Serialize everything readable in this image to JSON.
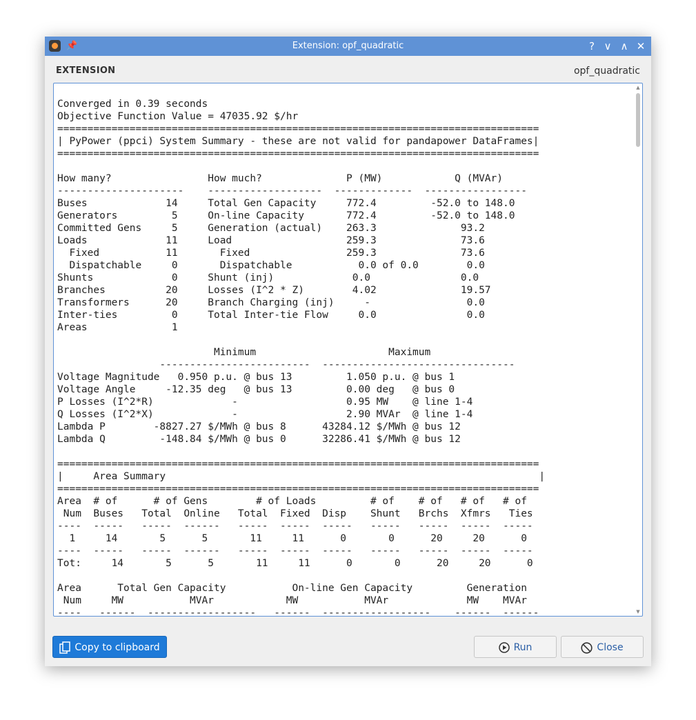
{
  "window": {
    "title": "Extension: opf_quadratic",
    "controls": [
      "?",
      "∨",
      "∧",
      "✕"
    ]
  },
  "header": {
    "section_label": "EXTENSION",
    "extension_name": "opf_quadratic"
  },
  "output": {
    "lines": [
      "Converged in 0.39 seconds",
      "Objective Function Value = 47035.92 $/hr",
      "================================================================================",
      "| PyPower (ppci) System Summary - these are not valid for pandapower DataFrames|",
      "================================================================================",
      "",
      "How many?                How much?              P (MW)            Q (MVAr)",
      "---------------------    -------------------  -------------  -----------------",
      "Buses             14     Total Gen Capacity     772.4         -52.0 to 148.0",
      "Generators         5     On-line Capacity       772.4         -52.0 to 148.0",
      "Committed Gens     5     Generation (actual)    263.3              93.2",
      "Loads             11     Load                   259.3              73.6",
      "  Fixed           11       Fixed                259.3              73.6",
      "  Dispatchable     0       Dispatchable           0.0 of 0.0        0.0",
      "Shunts             0     Shunt (inj)             0.0               0.0",
      "Branches          20     Losses (I^2 * Z)        4.02              19.57",
      "Transformers      20     Branch Charging (inj)     -                0.0",
      "Inter-ties         0     Total Inter-tie Flow     0.0               0.0",
      "Areas              1",
      "",
      "                          Minimum                      Maximum",
      "                 -------------------------  --------------------------------",
      "Voltage Magnitude   0.950 p.u. @ bus 13         1.050 p.u. @ bus 1",
      "Voltage Angle     -12.35 deg   @ bus 13         0.00 deg   @ bus 0",
      "P Losses (I^2*R)             -                  0.95 MW    @ line 1-4",
      "Q Losses (I^2*X)             -                  2.90 MVAr  @ line 1-4",
      "Lambda P        -8827.27 $/MWh @ bus 8      43284.12 $/MWh @ bus 12",
      "Lambda Q         -148.84 $/MWh @ bus 0      32286.41 $/MWh @ bus 12",
      "",
      "================================================================================",
      "|     Area Summary                                                              |",
      "================================================================================",
      "Area  # of      # of Gens        # of Loads         # of    # of   # of   # of",
      " Num  Buses   Total  Online   Total  Fixed  Disp    Shunt   Brchs  Xfmrs   Ties",
      "----  -----   -----  ------   -----  -----  -----   -----   -----  -----  -----",
      "  1     14       5      5       11     11      0       0      20     20      0",
      "----  -----   -----  ------   -----  -----  -----   -----   -----  -----  -----",
      "Tot:     14       5      5       11     11      0       0      20     20      0",
      "",
      "Area      Total Gen Capacity           On-line Gen Capacity         Generation",
      " Num     MW           MVAr            MW           MVAr             MW    MVAr",
      "----   ------  ------------------   ------  ------------------    ------  ------"
    ]
  },
  "buttons": {
    "copy_label": "Copy to clipboard",
    "run_label": "Run",
    "close_label": "Close"
  }
}
